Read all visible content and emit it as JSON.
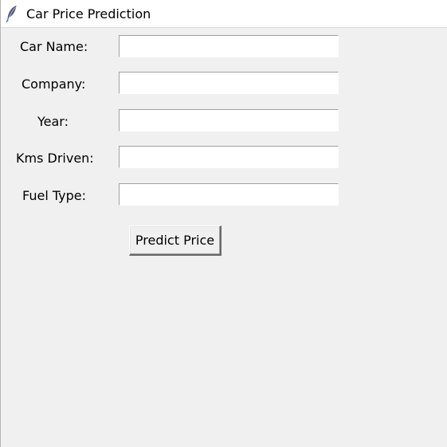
{
  "window": {
    "title": "Car Price Prediction",
    "icon": "tk-feather-icon"
  },
  "form": {
    "fields": [
      {
        "label": "Car Name:",
        "value": ""
      },
      {
        "label": "Company:",
        "value": ""
      },
      {
        "label": "Year:",
        "value": ""
      },
      {
        "label": "Kms Driven:",
        "value": ""
      },
      {
        "label": "Fuel Type:",
        "value": ""
      }
    ],
    "submit_label": "Predict Price"
  }
}
